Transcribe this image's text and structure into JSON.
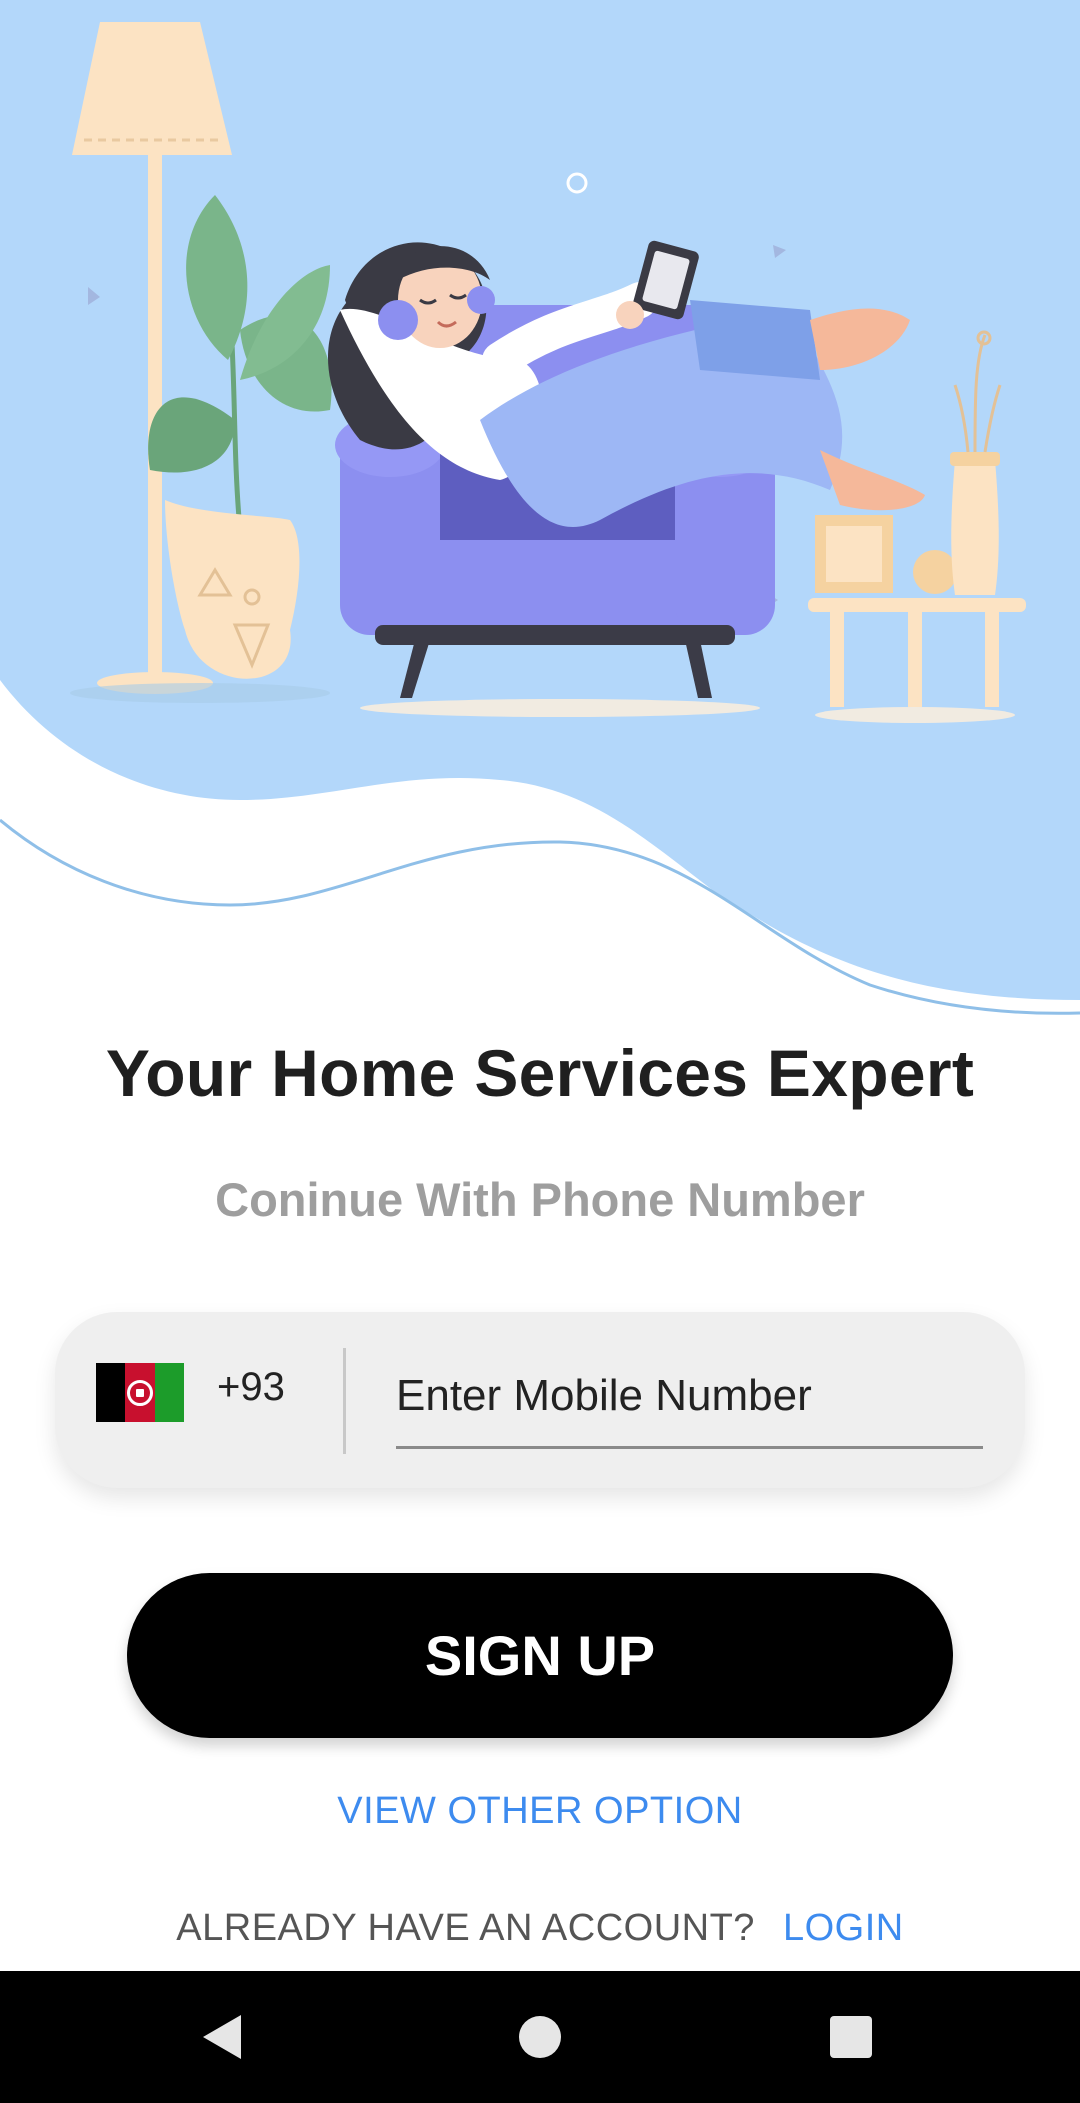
{
  "hero": {
    "illustration_icon": "woman-relaxing-in-armchair-illustration",
    "colors": {
      "sky": "#b3d7fa",
      "chair": "#8c8ff0",
      "accent_line": "#8fbfe8"
    }
  },
  "content": {
    "title": "Your Home Services Expert",
    "subtitle": "Coninue With Phone Number"
  },
  "phone_input": {
    "country_flag_icon": "afghanistan-flag-icon",
    "dial_code": "+93",
    "placeholder": "Enter Mobile Number",
    "value": ""
  },
  "actions": {
    "signup_label": "SIGN UP",
    "other_option_label": "VIEW OTHER OPTION",
    "account_question": "ALREADY HAVE AN ACCOUNT?",
    "login_label": "LOGIN",
    "link_color": "#3d8bef"
  },
  "navbar": {
    "back_icon": "back-triangle-icon",
    "home_icon": "home-circle-icon",
    "recents_icon": "recents-square-icon"
  }
}
